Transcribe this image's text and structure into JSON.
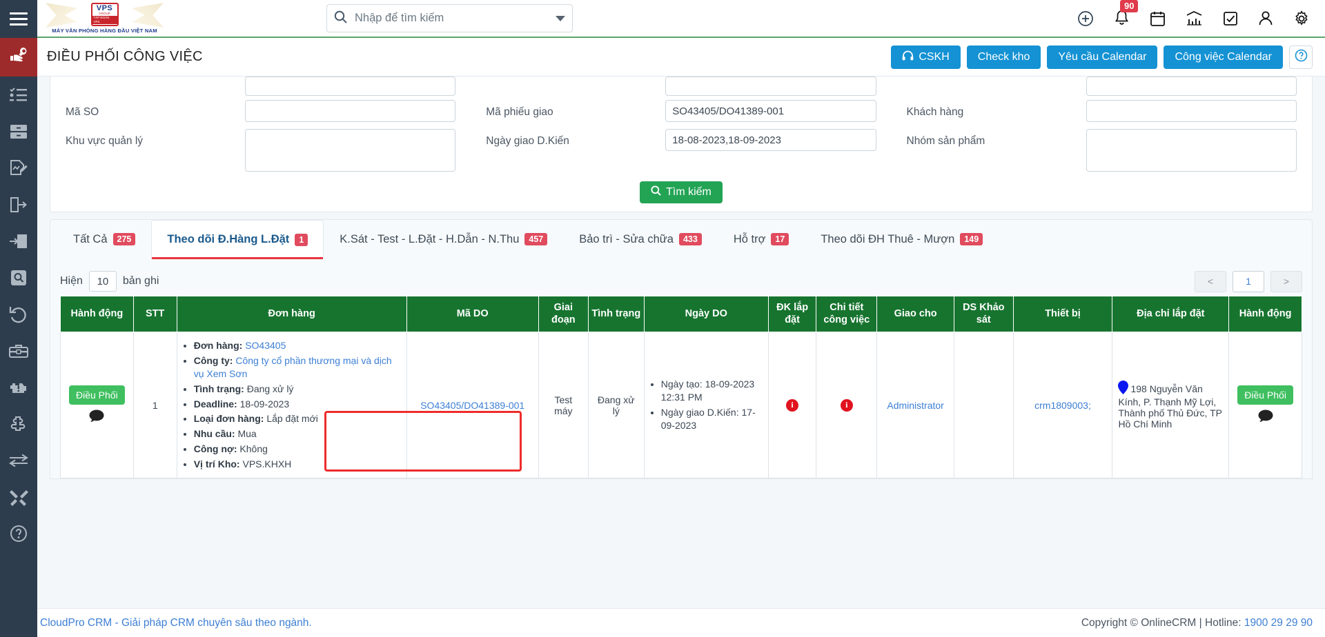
{
  "brand": {
    "badge_top": "VPS",
    "badge_mid": "GROUP",
    "badge_bot": "TẬP ĐOÀN VPS",
    "tagline": "MÁY VĂN PHÒNG HÀNG ĐẦU VIỆT NAM"
  },
  "topbar": {
    "search_placeholder": "Nhập để tìm kiếm",
    "search_value": "",
    "notification_count": "90",
    "icons": [
      "plus-circle-icon",
      "bell-icon",
      "calendar-icon",
      "chart-icon",
      "checkbox-icon",
      "user-icon",
      "gear-icon"
    ]
  },
  "pagehead": {
    "title": "ĐIỀU PHỐI CÔNG VIỆC",
    "buttons": [
      {
        "label": "CSKH",
        "icon": "headset-icon"
      },
      {
        "label": "Check kho",
        "icon": ""
      },
      {
        "label": "Yêu cầu Calendar",
        "icon": ""
      },
      {
        "label": "Công việc Calendar",
        "icon": ""
      }
    ],
    "help_icon": "question-circle-icon"
  },
  "search_form": {
    "col1": [
      {
        "label": "",
        "value": "",
        "type": "first"
      },
      {
        "label": "Mã SO",
        "value": "",
        "type": "normal"
      },
      {
        "label": "Khu vực quản lý",
        "value": "",
        "type": "tall"
      }
    ],
    "col2": [
      {
        "label": "",
        "value": "",
        "type": "first"
      },
      {
        "label": "Mã phiếu giao",
        "value": "SO43405/DO41389-001",
        "type": "normal"
      },
      {
        "label": "Ngày giao D.Kiến",
        "value": "18-08-2023,18-09-2023",
        "type": "normal"
      }
    ],
    "col3": [
      {
        "label": "",
        "value": "",
        "type": "first"
      },
      {
        "label": "Khách hàng",
        "value": "",
        "type": "normal"
      },
      {
        "label": "Nhóm sản phẩm",
        "value": "",
        "type": "tall"
      }
    ],
    "search_button": "Tìm kiếm"
  },
  "tabs": [
    {
      "label": "Tất Cả",
      "count": "275",
      "active": false
    },
    {
      "label": "Theo dõi Đ.Hàng L.Đặt",
      "count": "1",
      "active": true
    },
    {
      "label": "K.Sát - Test - L.Đặt - H.Dẫn - N.Thu",
      "count": "457",
      "active": false
    },
    {
      "label": "Bảo trì - Sửa chữa",
      "count": "433",
      "active": false
    },
    {
      "label": "Hỗ trợ",
      "count": "17",
      "active": false
    },
    {
      "label": "Theo dõi ĐH Thuê - Mượn",
      "count": "149",
      "active": false
    }
  ],
  "table_controls": {
    "show_label": "Hiện",
    "page_length": "10",
    "records_label": "bản ghi",
    "prev": "<",
    "current_page": "1",
    "next": ">"
  },
  "table": {
    "headers": [
      "Hành động",
      "STT",
      "Đơn hàng",
      "Mã DO",
      "Giai đoạn",
      "Tình trạng",
      "Ngày DO",
      "ĐK lắp đặt",
      "Chi tiết công việc",
      "Giao cho",
      "DS Khảo sát",
      "Thiết bị",
      "Địa chỉ lắp đặt",
      "Hành động"
    ],
    "rows": [
      {
        "action_label": "Điều Phối",
        "stt": "1",
        "order_details": [
          {
            "key": "Đơn hàng:",
            "value": "SO43405",
            "link": true
          },
          {
            "key": "Công ty:",
            "value": "Công ty cổ phần thương mại và dịch vụ Xem Sơn",
            "link": true
          },
          {
            "key": "Tình trạng:",
            "value": "Đang xử lý",
            "link": false
          },
          {
            "key": "Deadline:",
            "value": "18-09-2023",
            "link": false
          },
          {
            "key": "Loại đơn hàng:",
            "value": "Lắp đặt mới",
            "link": false
          },
          {
            "key": "Nhu cầu:",
            "value": "Mua",
            "link": false
          },
          {
            "key": "Công nợ:",
            "value": "Không",
            "link": false
          },
          {
            "key": "Vị trí Kho:",
            "value": "VPS.KHXH",
            "link": false
          }
        ],
        "ma_do": "SO43405/DO41389-001",
        "giai_doan": "Test máy",
        "tinh_trang": "Đang xử lý",
        "ngay_do": [
          {
            "key": "Ngày tạo:",
            "value": "18-09-2023 12:31 PM"
          },
          {
            "key": "Ngày giao D.Kiến:",
            "value": "17-09-2023"
          }
        ],
        "dk_lap_dat": "info-icon",
        "chi_tiet_cong_viec": "info-icon",
        "giao_cho": "Administrator",
        "ds_khao_sat": "",
        "thiet_bi": "crm1809003;",
        "dia_chi": "198 Nguyễn Văn Kính, P. Thạnh Mỹ Lợi, Thành phố Thủ Đức, TP Hồ Chí Minh",
        "action2_label": "Điều Phối"
      }
    ]
  },
  "footer": {
    "left": "CloudPro CRM - Giải pháp CRM chuyên sâu theo ngành.",
    "copyright": "Copyright © OnlineCRM",
    "separator": "|",
    "hotline_label": "Hotline:",
    "hotline": "1900 29 29 90"
  },
  "sidebar": {
    "items": [
      "hand-wrench-icon",
      "checklist-icon",
      "drawer-icon",
      "doc-edit-icon",
      "doc-out-icon",
      "doc-in-icon",
      "doc-search-icon",
      "undo-icon",
      "toolbox-icon",
      "engine-warning-icon",
      "puzzle-icon",
      "transfer-icon",
      "tools-icon",
      "help-circle-icon"
    ]
  },
  "colors": {
    "accent_blue": "#1492d4",
    "table_header_green": "#17742f",
    "badge_red": "#e04b5e",
    "highlight_red": "#ef2b2b",
    "sidebar_dark": "#2e3d4d",
    "sidebar_active": "#9e2b2b"
  }
}
